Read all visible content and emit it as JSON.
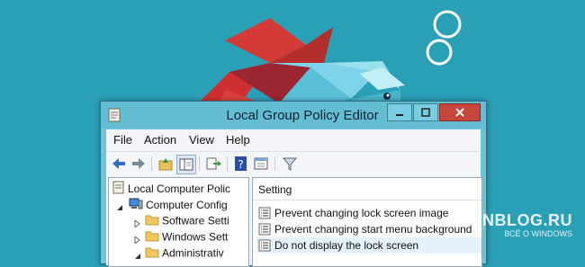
{
  "desktop": {
    "background_color": "#2aa0b6"
  },
  "window": {
    "title": "Local Group Policy Editor",
    "controls": [
      "minimize",
      "maximize",
      "close"
    ],
    "menu": [
      "File",
      "Action",
      "View",
      "Help"
    ],
    "toolbar_icons": [
      "back-icon",
      "forward-icon",
      "up-folder-icon",
      "show-hide-tree-icon",
      "export-list-icon",
      "help-icon",
      "properties-icon",
      "filter-icon"
    ]
  },
  "tree": {
    "items": [
      {
        "label": "Local Computer Polic"
      },
      {
        "label": "Computer Config"
      },
      {
        "label": "Software Setti"
      },
      {
        "label": "Windows Sett"
      },
      {
        "label": "Administrativ"
      }
    ]
  },
  "details": {
    "column_header": "Setting",
    "settings": [
      {
        "label": "Prevent changing lock screen image"
      },
      {
        "label": "Prevent changing start menu background"
      },
      {
        "label": "Do not display the lock screen"
      }
    ]
  },
  "watermark": {
    "title": "WINBLOG.RU",
    "subtitle": "ВСЁ О WINDOWS"
  }
}
